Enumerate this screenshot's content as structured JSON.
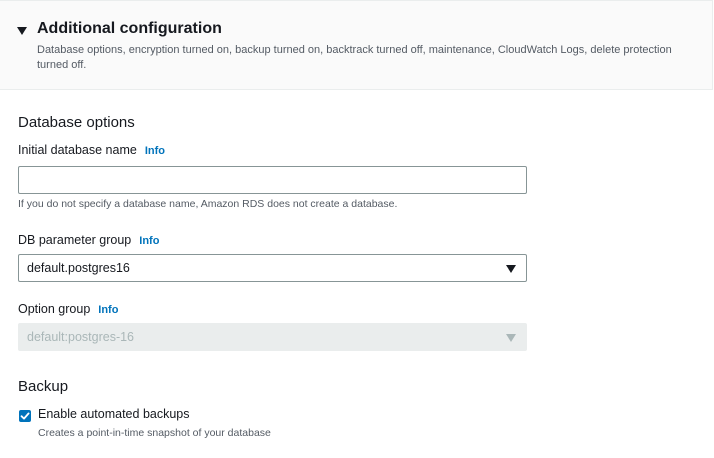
{
  "header": {
    "title": "Additional configuration",
    "description": "Database options, encryption turned on, backup turned on, backtrack turned off, maintenance, CloudWatch Logs, delete protection turned off."
  },
  "database_options": {
    "title": "Database options",
    "initial_db_name": {
      "label": "Initial database name",
      "info": "Info",
      "value": "",
      "hint": "If you do not specify a database name, Amazon RDS does not create a database."
    },
    "db_parameter_group": {
      "label": "DB parameter group",
      "info": "Info",
      "selected": "default.postgres16"
    },
    "option_group": {
      "label": "Option group",
      "info": "Info",
      "selected": "default:postgres-16",
      "disabled": true
    }
  },
  "backup": {
    "title": "Backup",
    "automated_backups": {
      "label": "Enable automated backups",
      "checked": true,
      "description": "Creates a point-in-time snapshot of your database"
    }
  },
  "colors": {
    "link": "#0073bb",
    "text": "#16191f",
    "muted": "#545b64",
    "disabled_bg": "#eaeded"
  }
}
